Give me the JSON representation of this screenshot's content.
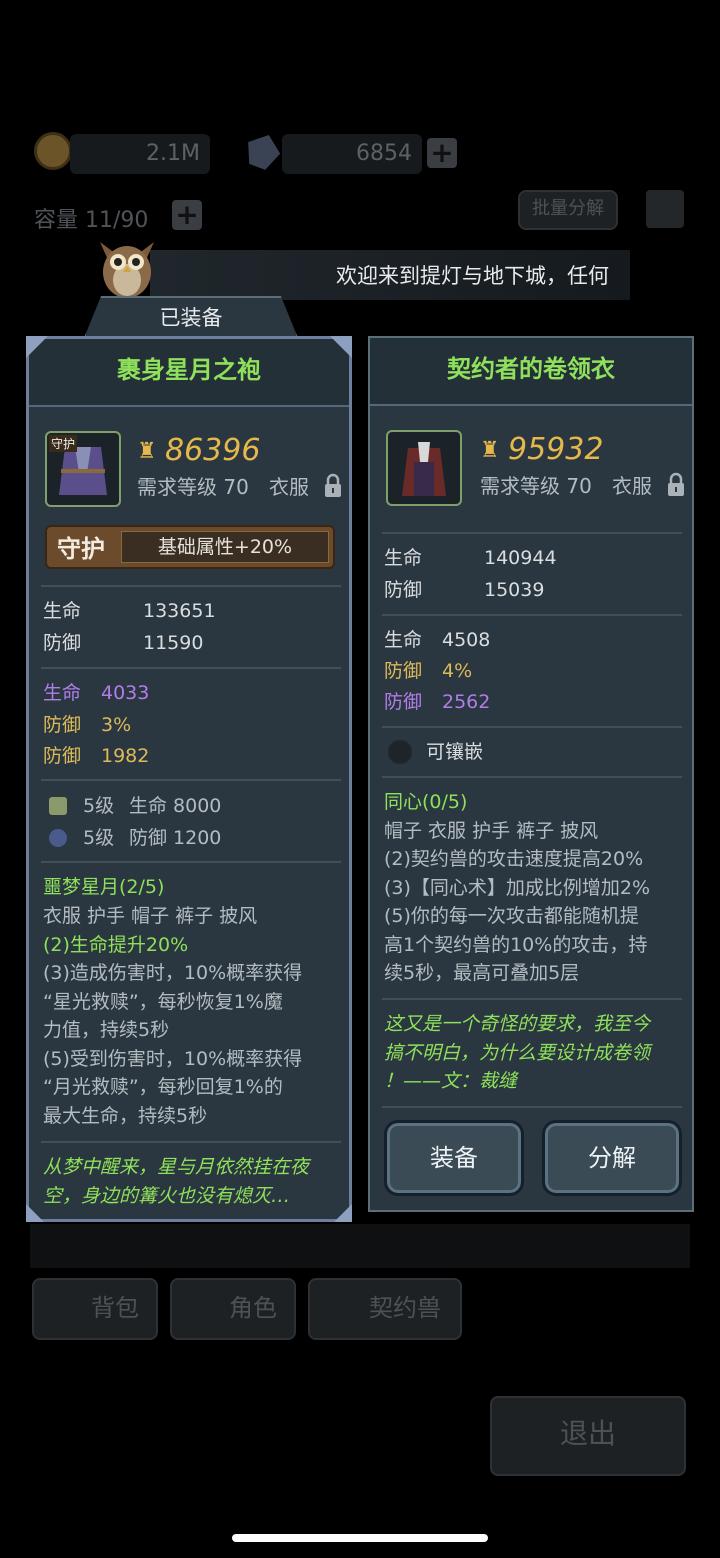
{
  "background": {
    "gold_amount": "2.1M",
    "gem_amount": "6854",
    "capacity": "容量 11/90",
    "batch_decompose": "批量分解",
    "welcome_text": "欢迎来到提灯与地下城，任何",
    "tabs": [
      "背包",
      "角色",
      "契约兽"
    ],
    "exit": "退出"
  },
  "equipped_label": "已装备",
  "left": {
    "name": "裹身星月之袍",
    "power": "86396",
    "level_req": "需求等级 70",
    "slot": "衣服",
    "icon_badge": "守护",
    "guard_label": "守护",
    "guard_bonus": "基础属性+20%",
    "base_stats": [
      {
        "name": "生命",
        "value": "133651"
      },
      {
        "name": "防御",
        "value": "11590"
      }
    ],
    "extra_stats": [
      {
        "name": "生命",
        "value": "4033",
        "color": "purple"
      },
      {
        "name": "防御",
        "value": "3%",
        "color": "gold"
      },
      {
        "name": "防御",
        "value": "1982",
        "color": "gold"
      }
    ],
    "gems": [
      {
        "level": "5级",
        "text": "生命 8000"
      },
      {
        "level": "5级",
        "text": "防御 1200"
      }
    ],
    "set_name": "噩梦星月(2/5)",
    "set_pieces": "衣服 护手 帽子 裤子 披风",
    "set_bonus_active": "(2)生命提升20%",
    "set_bonus_lines": [
      "(3)造成伤害时，10%概率获得",
      "“星光救赎”，每秒恢复1%魔",
      "力值，持续5秒",
      "(5)受到伤害时，10%概率获得",
      "“月光救赎”，每秒回复1%的",
      "最大生命，持续5秒"
    ],
    "flavor_lines": [
      "从梦中醒来，星与月依然挂在夜",
      "空，身边的篝火也没有熄灭…"
    ]
  },
  "right": {
    "name": "契约者的卷领衣",
    "power": "95932",
    "level_req": "需求等级 70",
    "slot": "衣服",
    "base_stats": [
      {
        "name": "生命",
        "value": "140944"
      },
      {
        "name": "防御",
        "value": "15039"
      }
    ],
    "extra_stats": [
      {
        "name": "生命",
        "value": "4508",
        "color": "white"
      },
      {
        "name": "防御",
        "value": "4%",
        "color": "gold"
      },
      {
        "name": "防御",
        "value": "2562",
        "color": "purple"
      }
    ],
    "socket": "可镶嵌",
    "set_name": "同心(0/5)",
    "set_pieces": "帽子 衣服 护手 裤子 披风",
    "set_bonus_lines": [
      "(2)契约兽的攻击速度提高20%",
      "(3)【同心术】加成比例增加2%",
      "(5)你的每一次攻击都能随机提",
      "高1个契约兽的10%的攻击，持",
      "续5秒，最高可叠加5层"
    ],
    "flavor_lines": [
      "这又是一个奇怪的要求，我至今",
      "搞不明白，为什么要设计成卷领",
      "！——文：裁缝"
    ],
    "equip_button": "装备",
    "decompose_button": "分解"
  }
}
